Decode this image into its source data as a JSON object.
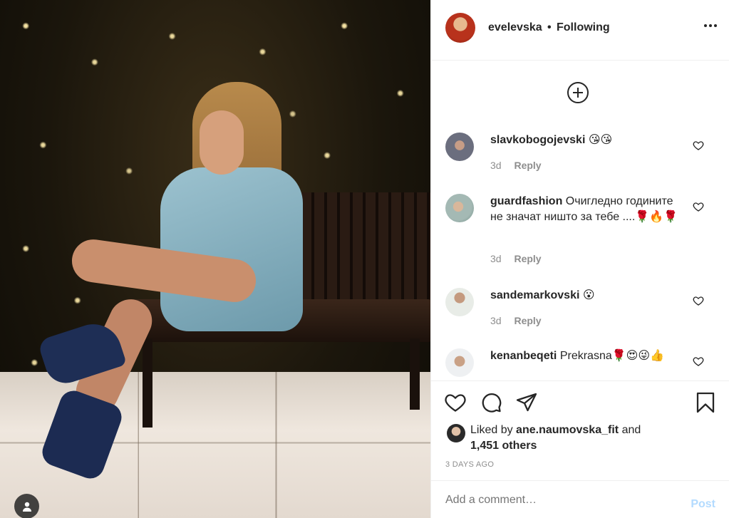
{
  "post": {
    "username": "evelevska",
    "separator": "•",
    "follow_status": "Following",
    "load_more_icon": "plus-circle-icon"
  },
  "comments": [
    {
      "username": "slavkobogojevski",
      "text": "",
      "emojis": [
        "😘",
        "😘"
      ],
      "age": "3d",
      "reply_label": "Reply"
    },
    {
      "username": "guardfashion",
      "text": "Очигледно годините не значат ништо за тебе ....",
      "emojis": [
        "🌹",
        "🔥",
        "🌹"
      ],
      "age": "3d",
      "reply_label": "Reply"
    },
    {
      "username": "sandemarkovski",
      "text": "",
      "emojis": [
        "😮"
      ],
      "age": "3d",
      "reply_label": "Reply"
    },
    {
      "username": "kenanbeqeti",
      "text": "Prekrasna",
      "emojis": [
        "🌹",
        "😍",
        "😜",
        "👍"
      ],
      "age": "",
      "reply_label": ""
    }
  ],
  "actions": {
    "like_icon": "heart-icon",
    "comment_icon": "comment-icon",
    "share_icon": "paper-plane-icon",
    "save_icon": "bookmark-icon"
  },
  "likes": {
    "prefix": "Liked by",
    "user": "ane.naumovska_fit",
    "joiner": "and",
    "others": "1,451 others"
  },
  "timestamp": "3 DAYS AGO",
  "add_comment": {
    "placeholder": "Add a comment…",
    "post_label": "Post"
  },
  "colors": {
    "text": "#262626",
    "secondary": "#8e8e8e",
    "post_disabled": "#b3dbff",
    "border": "#efefef"
  }
}
